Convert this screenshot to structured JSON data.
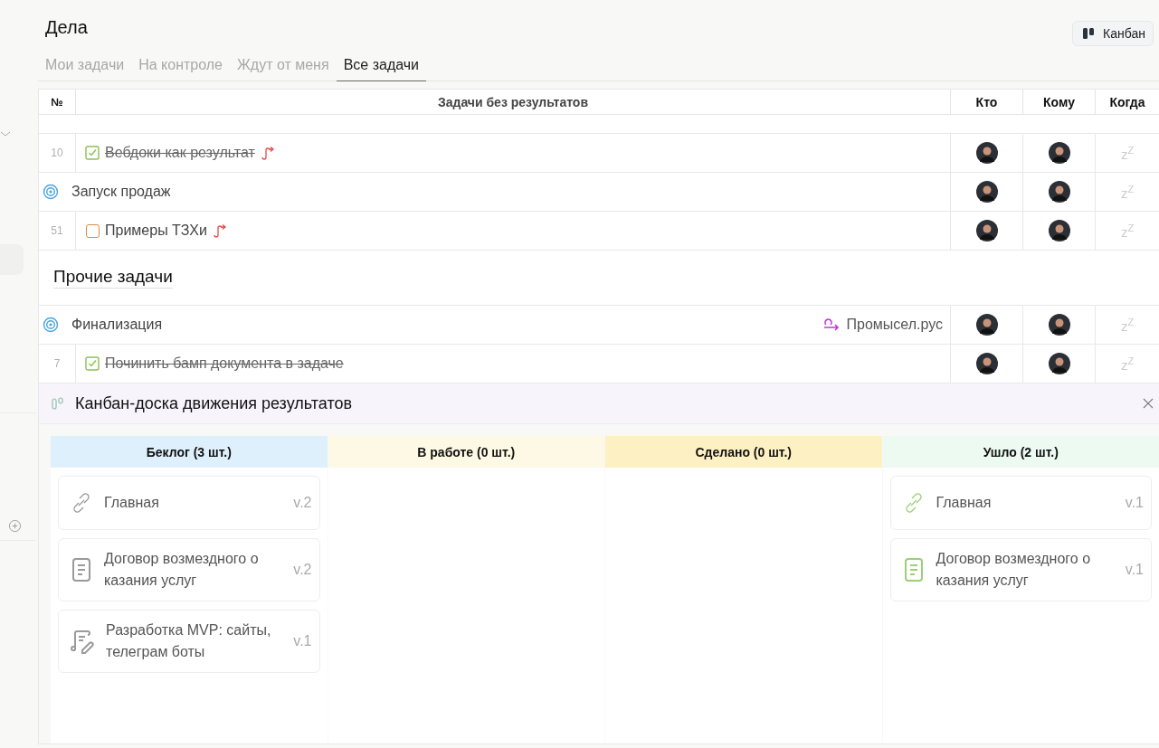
{
  "page": {
    "title": "Дела",
    "view_button": "Канбан"
  },
  "tabs": [
    {
      "label": "Мои задачи",
      "selected": false
    },
    {
      "label": "На контроле",
      "selected": false
    },
    {
      "label": "Ждут от меня",
      "selected": false
    },
    {
      "label": "Все задачи",
      "selected": true
    }
  ],
  "table": {
    "columns": [
      "№",
      "Задачи без результатов",
      "Кто",
      "Кому",
      "Когда"
    ],
    "rows": [
      {
        "kind": "task",
        "number": "10",
        "title": "Вебдоки как результат",
        "done": true,
        "linked": true,
        "when": "z$^{Z}$"
      },
      {
        "kind": "goal",
        "title": "Запуск продаж",
        "when": "z$^{Z}$"
      },
      {
        "kind": "task",
        "number": "51",
        "title": "Примеры ТЗХи",
        "done": false,
        "linked": true,
        "when": "z$^{Z}$"
      }
    ],
    "section": {
      "title": "Прочие задачи",
      "rows": [
        {
          "kind": "goal",
          "title": "Финализация",
          "project": "Промысел.рус",
          "when": "z$^{Z}$"
        },
        {
          "kind": "task",
          "number": "7",
          "title": "Починить бамп документа в задаче",
          "done": true,
          "linked": false,
          "when": "z$^{Z}$"
        }
      ]
    }
  },
  "kanban": {
    "title": "Канбан-доска движения результатов",
    "columns": [
      {
        "title": "Беклог (3 шт.)",
        "color": "#dff0fd",
        "cards": [
          {
            "kind": "link",
            "title": "Главная",
            "version": "v.2",
            "color": "#9a9a9a"
          },
          {
            "kind": "document",
            "title": "Договор возмездного о казания услуг",
            "version": "v.2",
            "color": "#9a9a9a"
          },
          {
            "kind": "script",
            "title": "Разработка MVP: сайты, телеграм боты",
            "version": "v.1",
            "color": "#9a9a9a"
          }
        ]
      },
      {
        "title": "В работе (0 шт.)",
        "color": "#fdf9e4"
      },
      {
        "title": "Сделано (0 шт.)",
        "color": "#fdf0c3"
      },
      {
        "title": "Ушло (2 шт.)",
        "color": "#edfaf1",
        "cards": [
          {
            "kind": "link",
            "title": "Главная",
            "version": "v.1",
            "color": "#9ccf78"
          },
          {
            "kind": "document",
            "title": "Договор возмездного о казания услуг",
            "version": "v.1",
            "color": "#9ccf78"
          }
        ]
      }
    ]
  }
}
